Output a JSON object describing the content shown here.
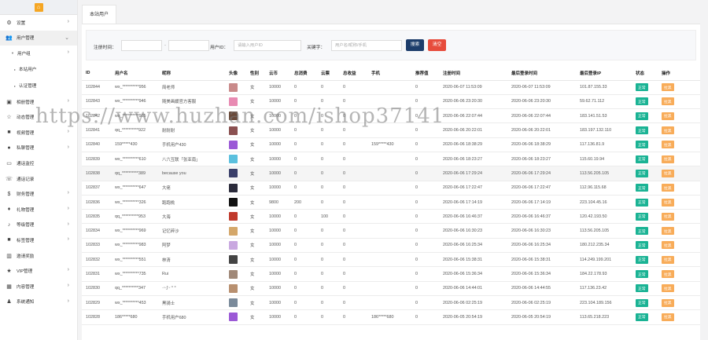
{
  "sidebar": {
    "logo_glyph": "⌂",
    "items": [
      {
        "label": "设置",
        "icon": "gear-icon",
        "glyph": "⚙",
        "chev": "›",
        "kind": "top"
      },
      {
        "label": "用户管理",
        "icon": "users-icon",
        "glyph": "👥",
        "chev": "⌄",
        "kind": "top",
        "active": true
      },
      {
        "label": "用户组",
        "icon": "caret-down-icon",
        "glyph": "▼",
        "chev": "›",
        "kind": "sub"
      },
      {
        "label": "本站用户",
        "kind": "sub2"
      },
      {
        "label": "认证管理",
        "kind": "sub2"
      },
      {
        "label": "相册管理",
        "icon": "image-icon",
        "glyph": "▣",
        "chev": "›",
        "kind": "top"
      },
      {
        "label": "动态管理",
        "icon": "star-outline-icon",
        "glyph": "☆",
        "chev": "",
        "kind": "top"
      },
      {
        "label": "视频管理",
        "icon": "video-icon",
        "glyph": "■",
        "chev": "›",
        "kind": "top"
      },
      {
        "label": "私聊管理",
        "icon": "chat-icon",
        "glyph": "●",
        "chev": "›",
        "kind": "top"
      },
      {
        "label": "通话监控",
        "icon": "monitor-icon",
        "glyph": "▭",
        "chev": "",
        "kind": "top"
      },
      {
        "label": "通话记录",
        "icon": "phone-icon",
        "glyph": "☏",
        "chev": "",
        "kind": "top"
      },
      {
        "label": "财务管理",
        "icon": "finance-icon",
        "glyph": "$",
        "chev": "›",
        "kind": "top"
      },
      {
        "label": "礼物管理",
        "icon": "gift-icon",
        "glyph": "♦",
        "chev": "›",
        "kind": "top"
      },
      {
        "label": "等级管理",
        "icon": "level-icon",
        "glyph": "♪",
        "chev": "›",
        "kind": "top"
      },
      {
        "label": "标签管理",
        "icon": "tag-icon",
        "glyph": "■",
        "chev": "›",
        "kind": "top"
      },
      {
        "label": "邀请奖励",
        "icon": "chart-icon",
        "glyph": "▥",
        "chev": "",
        "kind": "top"
      },
      {
        "label": "VIP管理",
        "icon": "star-icon",
        "glyph": "★",
        "chev": "›",
        "kind": "top"
      },
      {
        "label": "内容管理",
        "icon": "grid-icon",
        "glyph": "▦",
        "chev": "›",
        "kind": "top"
      },
      {
        "label": "系统通知",
        "icon": "bell-icon",
        "glyph": "♟",
        "chev": "›",
        "kind": "top"
      }
    ]
  },
  "tabs": [
    {
      "label": "本站用户"
    }
  ],
  "filters": {
    "reg_time_label": "注册时间：",
    "dash": "-",
    "uid_label": "用户ID：",
    "uid_placeholder": "请输入用户ID",
    "keyword_label": "关键字：",
    "keyword_placeholder": "用户名/昵称/手机",
    "search_button": "搜索",
    "clear_button": "清空"
  },
  "table": {
    "headers": [
      "ID",
      "用户名",
      "昵称",
      "头像",
      "性别",
      "云币",
      "总消费",
      "云票",
      "总收益",
      "手机",
      "推荐值",
      "注册时间",
      "最后登录时间",
      "最后登录IP",
      "状态",
      "操作"
    ],
    "rows": [
      {
        "id": "102844",
        "username": "wx_**********956",
        "nickname": "简老师",
        "avatar_color": "#c98a8a",
        "gender": "女",
        "coins": "10000",
        "spend": "0",
        "tickets": "0",
        "income": "0",
        "phone": "",
        "rec": "0",
        "reg": "2020-06-07 11:53:09",
        "last": "2020-06-07 11:53:09",
        "ip": "101.87.155.33",
        "status": "正常",
        "op": "拉黑"
      },
      {
        "id": "102843",
        "username": "wx_**********946",
        "nickname": "随美画媛官方客服",
        "avatar_color": "#e88ab2",
        "gender": "女",
        "coins": "10000",
        "spend": "0",
        "tickets": "0",
        "income": "0",
        "phone": "",
        "rec": "0",
        "reg": "2020-06-06 23:20:30",
        "last": "2020-06-06 23:20:30",
        "ip": "59.62.71.112",
        "status": "正常",
        "op": "拉黑"
      },
      {
        "id": "102842",
        "username": "wx_**********925",
        "nickname": "",
        "avatar_color": "#6a4a3a",
        "gender": "女",
        "coins": "10000",
        "spend": "0",
        "tickets": "0",
        "income": "0",
        "phone": "",
        "rec": "0",
        "reg": "2020-06-06 22:07:44",
        "last": "2020-06-06 22:07:44",
        "ip": "183.141.51.53",
        "status": "正常",
        "op": "拉黑"
      },
      {
        "id": "102841",
        "username": "qq_**********922",
        "nickname": "耐耐耐",
        "avatar_color": "#8a5050",
        "gender": "女",
        "coins": "10000",
        "spend": "0",
        "tickets": "0",
        "income": "0",
        "phone": "",
        "rec": "0",
        "reg": "2020-06-06 20:22:01",
        "last": "2020-06-06 20:22:01",
        "ip": "183.197.132.110",
        "status": "正常",
        "op": "拉黑"
      },
      {
        "id": "102840",
        "username": "159*****430",
        "nickname": "手机用户430",
        "avatar_color": "#9b59d6",
        "gender": "女",
        "coins": "10000",
        "spend": "0",
        "tickets": "0",
        "income": "0",
        "phone": "159*****430",
        "rec": "0",
        "reg": "2020-06-06 18:38:29",
        "last": "2020-06-06 18:38:29",
        "ip": "117.136.81.9",
        "status": "正常",
        "op": "拉黑"
      },
      {
        "id": "102839",
        "username": "wx_**********610",
        "nickname": "八六互联「张亚南」",
        "avatar_color": "#5bc0de",
        "gender": "女",
        "coins": "10000",
        "spend": "0",
        "tickets": "0",
        "income": "0",
        "phone": "",
        "rec": "0",
        "reg": "2020-06-06 18:23:27",
        "last": "2020-06-06 18:23:27",
        "ip": "115.60.19.94",
        "status": "正常",
        "op": "拉黑"
      },
      {
        "id": "102838",
        "username": "qq_**********389",
        "nickname": "because you",
        "avatar_color": "#3a3f6a",
        "gender": "女",
        "coins": "10000",
        "spend": "0",
        "tickets": "0",
        "income": "0",
        "phone": "",
        "rec": "0",
        "reg": "2020-06-06 17:29:24",
        "last": "2020-06-06 17:29:24",
        "ip": "113.56.205.105",
        "status": "正常",
        "op": "拉黑",
        "highlight": true
      },
      {
        "id": "102837",
        "username": "wx_**********647",
        "nickname": "大佬",
        "avatar_color": "#2a2a3a",
        "gender": "女",
        "coins": "10000",
        "spend": "0",
        "tickets": "0",
        "income": "0",
        "phone": "",
        "rec": "0",
        "reg": "2020-06-06 17:22:47",
        "last": "2020-06-06 17:22:47",
        "ip": "112.96.115.68",
        "status": "正常",
        "op": "拉黑"
      },
      {
        "id": "102836",
        "username": "wx_**********326",
        "nickname": "跑跑桃",
        "avatar_color": "#111111",
        "gender": "女",
        "coins": "9800",
        "spend": "200",
        "tickets": "0",
        "income": "0",
        "phone": "",
        "rec": "0",
        "reg": "2020-06-06 17:14:19",
        "last": "2020-06-06 17:14:19",
        "ip": "223.104.45.16",
        "status": "正常",
        "op": "拉黑"
      },
      {
        "id": "102835",
        "username": "qq_**********953",
        "nickname": "大海",
        "avatar_color": "#c0392b",
        "gender": "女",
        "coins": "10000",
        "spend": "0",
        "tickets": "100",
        "income": "0",
        "phone": "",
        "rec": "0",
        "reg": "2020-06-06 16:46:37",
        "last": "2020-06-06 16:46:37",
        "ip": "120.42.193.50",
        "status": "正常",
        "op": "拉黑"
      },
      {
        "id": "102834",
        "username": "wx_**********969",
        "nickname": "记忆碎沙",
        "avatar_color": "#d4a76a",
        "gender": "女",
        "coins": "10000",
        "spend": "0",
        "tickets": "0",
        "income": "0",
        "phone": "",
        "rec": "0",
        "reg": "2020-06-06 16:30:23",
        "last": "2020-06-06 16:30:23",
        "ip": "113.56.205.105",
        "status": "正常",
        "op": "拉黑"
      },
      {
        "id": "102833",
        "username": "wx_**********983",
        "nickname": "阿梦",
        "avatar_color": "#c9a8e0",
        "gender": "女",
        "coins": "10000",
        "spend": "0",
        "tickets": "0",
        "income": "0",
        "phone": "",
        "rec": "0",
        "reg": "2020-06-06 16:25:34",
        "last": "2020-06-06 16:25:34",
        "ip": "180.212.235.34",
        "status": "正常",
        "op": "拉黑"
      },
      {
        "id": "102832",
        "username": "wx_**********551",
        "nickname": "林清",
        "avatar_color": "#444444",
        "gender": "女",
        "coins": "10000",
        "spend": "0",
        "tickets": "0",
        "income": "0",
        "phone": "",
        "rec": "0",
        "reg": "2020-06-06 15:38:31",
        "last": "2020-06-06 15:38:31",
        "ip": "114.249.199.201",
        "status": "正常",
        "op": "拉黑"
      },
      {
        "id": "102831",
        "username": "wx_**********735",
        "nickname": "Rui",
        "avatar_color": "#a08878",
        "gender": "女",
        "coins": "10000",
        "spend": "0",
        "tickets": "0",
        "income": "0",
        "phone": "",
        "rec": "0",
        "reg": "2020-06-06 15:36:34",
        "last": "2020-06-06 15:36:34",
        "ip": "184.22.178.93",
        "status": "正常",
        "op": "拉黑"
      },
      {
        "id": "102830",
        "username": "qq_**********347",
        "nickname": "·ᵕ·ʃ ᵕ ° °",
        "avatar_color": "#b89070",
        "gender": "女",
        "coins": "10000",
        "spend": "0",
        "tickets": "0",
        "income": "0",
        "phone": "",
        "rec": "0",
        "reg": "2020-06-06 14:44:01",
        "last": "2020-06-06 14:44:55",
        "ip": "117.136.23.42",
        "status": "正常",
        "op": "拉黑"
      },
      {
        "id": "102829",
        "username": "wx_**********453",
        "nickname": "黑骑士",
        "avatar_color": "#7a8a9a",
        "gender": "女",
        "coins": "10000",
        "spend": "0",
        "tickets": "0",
        "income": "0",
        "phone": "",
        "rec": "0",
        "reg": "2020-06-06 02:25:19",
        "last": "2020-06-06 02:25:19",
        "ip": "223.104.189.156",
        "status": "正常",
        "op": "拉黑"
      },
      {
        "id": "102828",
        "username": "186*****680",
        "nickname": "手机用户680",
        "avatar_color": "#9b59d6",
        "gender": "女",
        "coins": "10000",
        "spend": "0",
        "tickets": "0",
        "income": "0",
        "phone": "186*****680",
        "rec": "0",
        "reg": "2020-06-05 20:54:19",
        "last": "2020-06-05 20:54:19",
        "ip": "113.65.218.223",
        "status": "正常",
        "op": "拉黑"
      }
    ]
  },
  "watermark": "https://www.huzhan.com/ishop37141",
  "colors": {
    "status": "#1ab394",
    "op": "#f8ac59",
    "search": "#1d3d6b",
    "clear": "#e74c3c",
    "logo": "#f5a623"
  }
}
